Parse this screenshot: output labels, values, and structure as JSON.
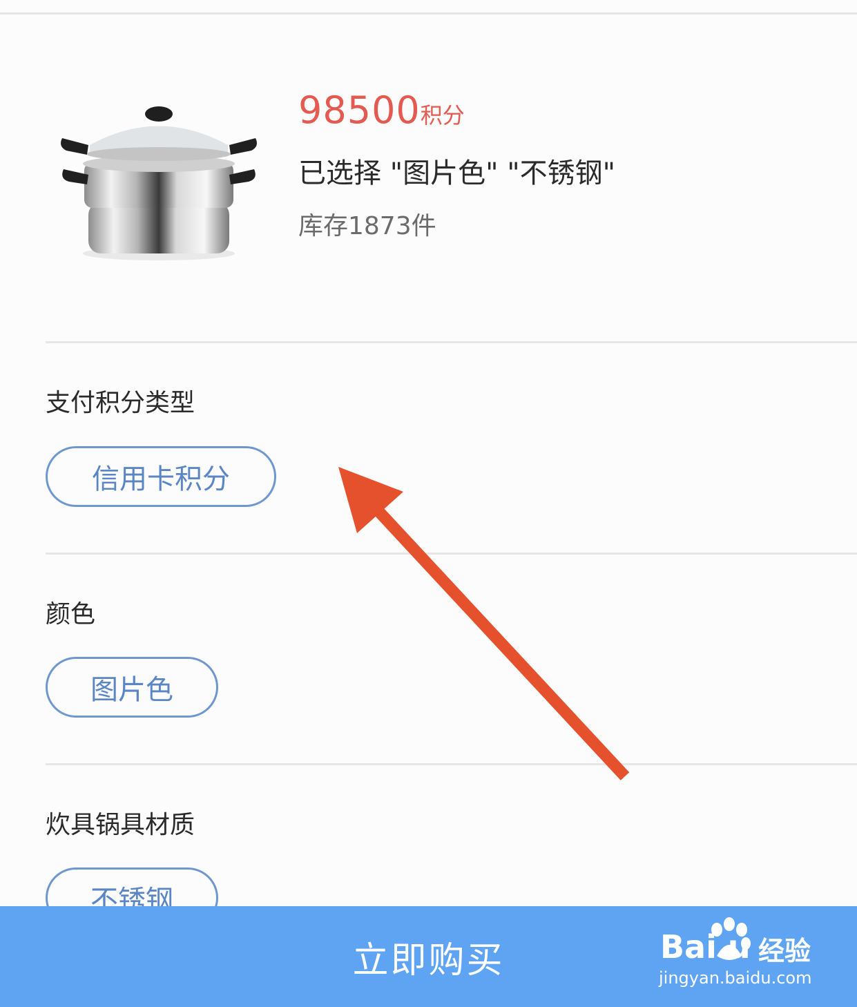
{
  "product": {
    "image_icon": "steamer-pot-image",
    "price_value": "98500",
    "price_unit": "积分",
    "selected_text": "已选择 \"图片色\" \"不锈钢\"",
    "stock_text": "库存1873件"
  },
  "sections": [
    {
      "title": "支付积分类型",
      "option": "信用卡积分"
    },
    {
      "title": "颜色",
      "option": "图片色"
    },
    {
      "title": "炊具锅具材质",
      "option": "不锈钢"
    }
  ],
  "buy_button": {
    "label": "立即购买"
  },
  "watermark": {
    "brand": "Bai  u",
    "product": "经验",
    "url": "jingyan.baidu.com",
    "icon": "paw-icon"
  },
  "annotation": {
    "icon": "red-arrow-icon",
    "color": "#e5502d"
  },
  "colors": {
    "price": "#e35a50",
    "option_border": "#6e97cf",
    "option_text": "#5b86c5",
    "buy_bar": "#5ea4f3"
  }
}
